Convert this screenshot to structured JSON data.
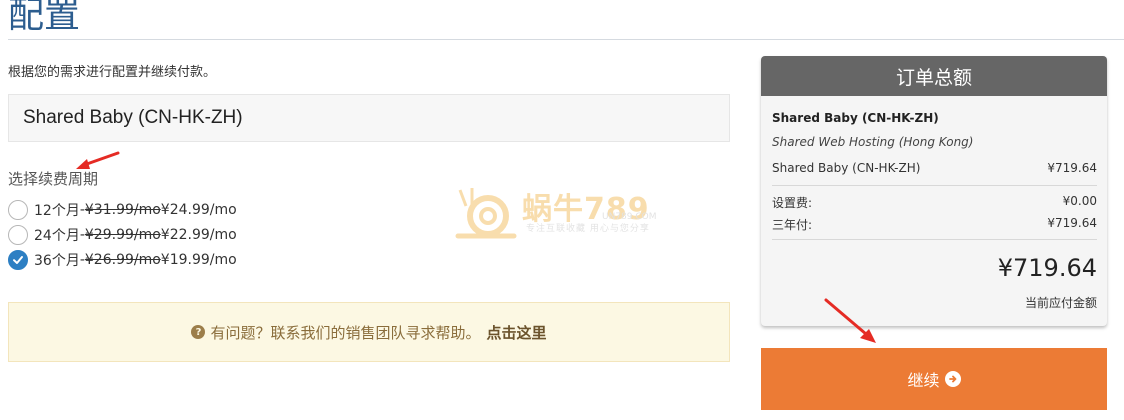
{
  "page": {
    "title": "配置",
    "intro": "根据您的需求进行配置并继续付款。"
  },
  "product": {
    "name": "Shared Baby (CN-HK-ZH)"
  },
  "billing": {
    "label": "选择续费周期",
    "options": [
      {
        "term": "12个月",
        "separator": " - ",
        "old_price": "¥31.99/mo",
        "new_price": " ¥24.99/mo",
        "checked": false
      },
      {
        "term": "24个月",
        "separator": " - ",
        "old_price": "¥29.99/mo",
        "new_price": " ¥22.99/mo",
        "checked": false
      },
      {
        "term": "36个月",
        "separator": " - ",
        "old_price": "¥26.99/mo",
        "new_price": " ¥19.99/mo",
        "checked": true
      }
    ]
  },
  "help": {
    "icon": "question-circle-icon",
    "text": "有问题？联系我们的销售团队寻求帮助。",
    "link": "点击这里"
  },
  "watermark": {
    "brand": "蜗牛789",
    "domain": "UN789.COM",
    "slogan": "专注互联收藏  用心与您分享"
  },
  "summary": {
    "header": "订单总额",
    "product_name": "Shared Baby (CN-HK-ZH)",
    "product_group": "Shared Web Hosting (Hong Kong)",
    "product_line": {
      "label": "Shared Baby (CN-HK-ZH)",
      "value": "¥719.64"
    },
    "setup_fee": {
      "label": "设置费:",
      "value": "¥0.00"
    },
    "triennial": {
      "label": "三年付:",
      "value": "¥719.64"
    },
    "total": "¥719.64",
    "due_today": "当前应付金额"
  },
  "continue": {
    "label": "继续",
    "icon": "arrow-circle-right-icon"
  },
  "colors": {
    "accent": "#ec7b35",
    "title": "#2c5d8f",
    "radio_checked": "#2d7fc3",
    "annotation": "#e52b24"
  }
}
